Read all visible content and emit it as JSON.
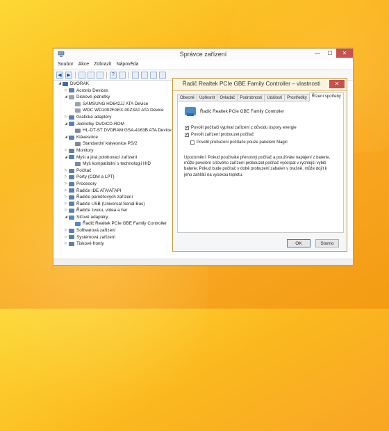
{
  "main_window": {
    "title": "Správce zařízení",
    "menu": [
      "Soubor",
      "Akce",
      "Zobrazit",
      "Nápověda"
    ],
    "window_controls": {
      "minimize": "—",
      "maximize": "☐",
      "close": "✕"
    },
    "tree": [
      {
        "label": "DVORAK",
        "level": 0,
        "expanded": true,
        "icon": "computer-icon"
      },
      {
        "label": "Acronis Devices",
        "level": 1,
        "expanded": false,
        "icon": "device-icon"
      },
      {
        "label": "Diskové jednotky",
        "level": 1,
        "expanded": true,
        "icon": "disk-icon"
      },
      {
        "label": "SAMSUNG HD642JJ ATA Device",
        "level": 2,
        "icon": "disk-icon"
      },
      {
        "label": "WDC WD1002FAEX-00Z3A0 ATA Device",
        "level": 2,
        "icon": "disk-icon"
      },
      {
        "label": "Grafické adaptéry",
        "level": 1,
        "expanded": false,
        "icon": "display-icon"
      },
      {
        "label": "Jednotky DVD/CD-ROM",
        "level": 1,
        "expanded": true,
        "icon": "dvd-icon"
      },
      {
        "label": "HL-DT-ST DVDRAM GSA-4163B ATA Device",
        "level": 2,
        "icon": "dvd-icon"
      },
      {
        "label": "Klávesnice",
        "level": 1,
        "expanded": true,
        "icon": "keyboard-icon"
      },
      {
        "label": "Standardní klávesnice PS/2",
        "level": 2,
        "icon": "keyboard-icon"
      },
      {
        "label": "Monitory",
        "level": 1,
        "expanded": false,
        "icon": "monitor-icon"
      },
      {
        "label": "Myši a jiná polohovací zařízení",
        "level": 1,
        "expanded": true,
        "icon": "mouse-icon"
      },
      {
        "label": "Myš kompatibilní s technologií HID",
        "level": 2,
        "icon": "mouse-icon"
      },
      {
        "label": "Počítač",
        "level": 1,
        "expanded": false,
        "icon": "computer-icon"
      },
      {
        "label": "Porty (COM a LPT)",
        "level": 1,
        "expanded": false,
        "icon": "port-icon"
      },
      {
        "label": "Procesory",
        "level": 1,
        "expanded": false,
        "icon": "cpu-icon"
      },
      {
        "label": "Řadiče IDE ATA/ATAPI",
        "level": 1,
        "expanded": false,
        "icon": "controller-icon"
      },
      {
        "label": "Řadiče paměťových zařízení",
        "level": 1,
        "expanded": false,
        "icon": "controller-icon"
      },
      {
        "label": "Řadiče USB (Universal Serial Bus)",
        "level": 1,
        "expanded": false,
        "icon": "usb-icon"
      },
      {
        "label": "Řadiče zvuku, videa a her",
        "level": 1,
        "expanded": false,
        "icon": "speaker-icon"
      },
      {
        "label": "Síťové adaptéry",
        "level": 1,
        "expanded": true,
        "icon": "network-icon"
      },
      {
        "label": "Řadič Realtek PCIe GBE Family Controller",
        "level": 2,
        "icon": "network-icon"
      },
      {
        "label": "Softwarová zařízení",
        "level": 1,
        "expanded": false,
        "icon": "device-icon"
      },
      {
        "label": "Systémová zařízení",
        "level": 1,
        "expanded": false,
        "icon": "device-icon"
      },
      {
        "label": "Tiskové fronty",
        "level": 1,
        "expanded": false,
        "icon": "printer-icon"
      }
    ]
  },
  "properties_dialog": {
    "title": "Řadič Realtek PCIe GBE Family Controller – vlastnosti",
    "close": "✕",
    "tabs": [
      "Obecné",
      "Upřesnit",
      "Ovladač",
      "Podrobnosti",
      "Události",
      "Prostředky",
      "Řízení spotřeby"
    ],
    "active_tab": "Řízení spotřeby",
    "device_name": "Řadič Realtek PCIe GBE Family Controller",
    "options": [
      {
        "label": "Povolit počítači vypínat zařízení z důvodu úspory energie",
        "checked": true
      },
      {
        "label": "Povolit zařízení probouzet počítač",
        "checked": true
      },
      {
        "label": "Povolit probuzení počítače pouze paketem Magic",
        "checked": false
      }
    ],
    "note": "Upozornění: Pokud používáte přenosný počítač a používáte napájení z baterie, může povolení síťového zařízení probouzet počítač vyčerpat v rychlejší vybití baterie. Pokud bude počítač v době probuzení zabalen v brašně, může dojít k jeho zahřátí na vysokou teplotu.",
    "ok_label": "OK",
    "cancel_label": "Storno"
  },
  "colors": {
    "accent_close": "#c75050",
    "desktop": "#f9b21e"
  }
}
